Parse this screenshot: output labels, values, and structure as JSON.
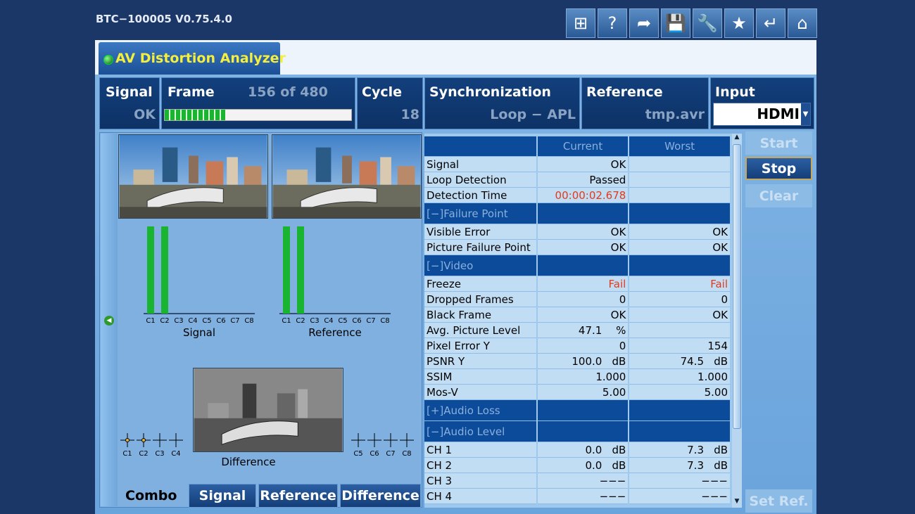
{
  "app": {
    "title": "BTC−100005 V0.75.4.0"
  },
  "toolbar": {
    "icons": [
      "windows-icon",
      "help-icon",
      "share-icon",
      "save-icon",
      "wrench-icon",
      "star-icon",
      "back-icon",
      "home-icon"
    ],
    "glyphs": [
      "⊞",
      "?",
      "➦",
      "💾",
      "🔧",
      "★",
      "↵",
      "⌂"
    ]
  },
  "tab": {
    "label": "AV Distortion Analyzer"
  },
  "status": {
    "signal_label": "Signal",
    "signal_value": "OK",
    "frame_label": "Frame",
    "frame_value": "156 of 480",
    "frame_progress": 0.325,
    "cycle_label": "Cycle",
    "cycle_value": "18",
    "sync_label": "Synchronization",
    "sync_value": "Loop − APL",
    "reference_label": "Reference",
    "reference_value": "tmp.avr",
    "input_label": "Input",
    "input_value": "HDMI"
  },
  "panels": {
    "signal_caption": "Signal",
    "reference_caption": "Reference",
    "difference_caption": "Difference",
    "channel_labels": [
      "C1",
      "C2",
      "C3",
      "C4",
      "C5",
      "C6",
      "C7",
      "C8"
    ],
    "signal_levels": [
      1,
      1,
      0,
      0,
      0,
      0,
      0,
      0
    ],
    "reference_levels": [
      1,
      1,
      0,
      0,
      0,
      0,
      0,
      0
    ]
  },
  "view_buttons": {
    "combo": "Combo",
    "signal": "Signal",
    "reference": "Reference",
    "difference": "Difference"
  },
  "table": {
    "header": {
      "current": "Current",
      "worst": "Worst"
    },
    "rows1": [
      {
        "label": "Signal",
        "current": "OK",
        "worst": ""
      },
      {
        "label": "Loop Detection",
        "current": "Passed",
        "worst": ""
      },
      {
        "label": "Detection Time",
        "current": "00:00:02.678",
        "worst": ""
      }
    ],
    "sec_failure": "[−]Failure Point",
    "rows2": [
      {
        "label": "Visible Error",
        "current": "OK",
        "worst": "OK"
      },
      {
        "label": "Picture Failure Point",
        "current": "OK",
        "worst": "OK"
      }
    ],
    "sec_video": "[−]Video",
    "rows3": [
      {
        "label": "Freeze",
        "current": "Fail",
        "worst": "Fail"
      },
      {
        "label": "Dropped Frames",
        "current": "0",
        "worst": "0"
      },
      {
        "label": "Black Frame",
        "current": "OK",
        "worst": "OK"
      },
      {
        "label": "Avg. Picture Level",
        "current": "47.1",
        "current_unit": "%",
        "worst": ""
      },
      {
        "label": "Pixel Error Y",
        "current": "0",
        "worst": "154"
      },
      {
        "label": "PSNR Y",
        "current": "100.0",
        "current_unit": "dB",
        "worst": "74.5",
        "worst_unit": "dB"
      },
      {
        "label": "SSIM",
        "current": "1.000",
        "worst": "1.000"
      },
      {
        "label": "Mos-V",
        "current": "5.00",
        "worst": "5.00"
      }
    ],
    "sec_audio_loss": "[+]Audio Loss",
    "sec_audio_level": "[−]Audio Level",
    "rows4": [
      {
        "label": "CH 1",
        "current": "0.0",
        "current_unit": "dB",
        "worst": "7.3",
        "worst_unit": "dB"
      },
      {
        "label": "CH 2",
        "current": "0.0",
        "current_unit": "dB",
        "worst": "7.3",
        "worst_unit": "dB"
      },
      {
        "label": "CH 3",
        "current": "−−−",
        "worst": "−−−"
      },
      {
        "label": "CH 4",
        "current": "−−−",
        "worst": "−−−"
      }
    ]
  },
  "controls": {
    "start": "Start",
    "stop": "Stop",
    "clear": "Clear",
    "set_ref": "Set Ref."
  },
  "colors": {
    "accent": "#0c4a9a",
    "title_yellow": "#f4ee3c",
    "bar_green": "#19b530",
    "fail_red": "#e23a1a"
  }
}
